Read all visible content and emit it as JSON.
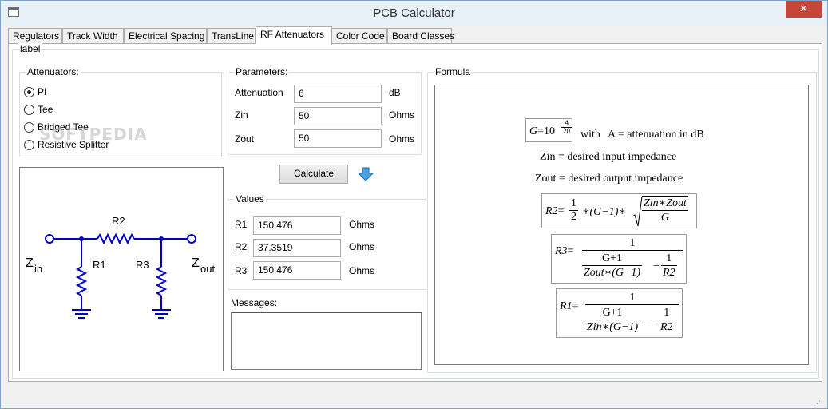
{
  "window": {
    "title": "PCB Calculator",
    "close_glyph": "✕"
  },
  "tabs": [
    {
      "label": "Regulators"
    },
    {
      "label": "Track Width"
    },
    {
      "label": "Electrical Spacing"
    },
    {
      "label": "TransLine"
    },
    {
      "label": "RF Attenuators",
      "active": true
    },
    {
      "label": "Color Code"
    },
    {
      "label": "Board Classes"
    }
  ],
  "panel": {
    "label": "label"
  },
  "attenuators": {
    "label": "Attenuators:",
    "options": [
      {
        "label": "PI",
        "selected": true
      },
      {
        "label": "Tee",
        "selected": false
      },
      {
        "label": "Bridged Tee",
        "selected": false
      },
      {
        "label": "Resistive Splitter",
        "selected": false
      }
    ]
  },
  "watermark": {
    "text": "SOFTPEDIA"
  },
  "schematic": {
    "r1": "R1",
    "r2": "R2",
    "r3": "R3",
    "zin_main": "Z",
    "zin_sub": "in",
    "zout_main": "Z",
    "zout_sub": "out",
    "color": "#0000c0"
  },
  "parameters": {
    "label": "Parameters:",
    "attenuation": {
      "label": "Attenuation",
      "value": "6",
      "unit": "dB"
    },
    "zin": {
      "label": "Zin",
      "value": "50",
      "unit": "Ohms"
    },
    "zout": {
      "label": "Zout",
      "value": "50",
      "unit": "Ohms"
    }
  },
  "calculate": {
    "label": "Calculate",
    "arrow_color": "#2e8bd6"
  },
  "values": {
    "label": "Values",
    "r1": {
      "label": "R1",
      "value": "150.476",
      "unit": "Ohms"
    },
    "r2": {
      "label": "R2",
      "value": "37.3519",
      "unit": "Ohms"
    },
    "r3": {
      "label": "R3",
      "value": "150.476",
      "unit": "Ohms"
    }
  },
  "messages": {
    "label": "Messages:",
    "text": ""
  },
  "formula": {
    "label": "Formula",
    "g_lhs": "G",
    "g_eq": "=10",
    "g_exp_num": "A",
    "g_exp_den": "20",
    "g_with": "with",
    "g_desc": "A = attenuation in dB",
    "zin_line": "Zin = desired input impedance",
    "zout_line": "Zout = desired output impedance",
    "r2_lhs": "R2",
    "r2_eq": "=",
    "r2_num": "1",
    "r2_den": "2",
    "r2_mid": "∗(G−1)∗",
    "r2_sqrt_num": "Zin∗Zout",
    "r2_sqrt_den": "G",
    "r3_lhs": "R3",
    "r3_eq": "=",
    "r3_num": "1",
    "r3_inner_num": "G+1",
    "r3_inner_den": "Zout∗(G−1)",
    "r3_minus": "−",
    "r3_right_num": "1",
    "r3_right_den": "R2",
    "r1_lhs": "R1",
    "r1_eq": "=",
    "r1_num": "1",
    "r1_inner_num": "G+1",
    "r1_inner_den": "Zin∗(G−1)",
    "r1_minus": "−",
    "r1_right_num": "1",
    "r1_right_den": "R2"
  },
  "statusbar": {
    "grip": "⋰"
  }
}
